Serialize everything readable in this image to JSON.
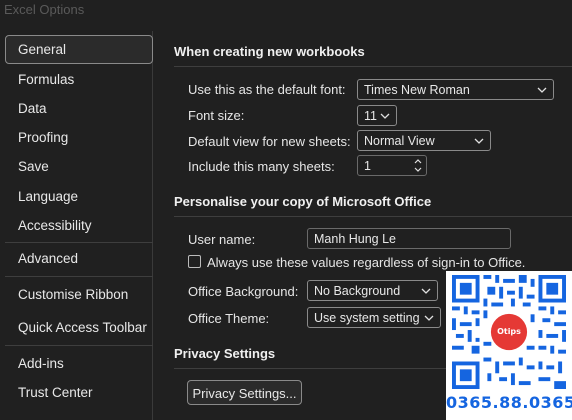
{
  "window": {
    "title": "Excel Options"
  },
  "sidebar": {
    "items": [
      {
        "label": "General"
      },
      {
        "label": "Formulas"
      },
      {
        "label": "Data"
      },
      {
        "label": "Proofing"
      },
      {
        "label": "Save"
      },
      {
        "label": "Language"
      },
      {
        "label": "Accessibility"
      },
      {
        "label": "Advanced"
      },
      {
        "label": "Customise Ribbon"
      },
      {
        "label": "Quick Access Toolbar"
      },
      {
        "label": "Add-ins"
      },
      {
        "label": "Trust Center"
      }
    ]
  },
  "sections": {
    "new_workbooks": {
      "heading": "When creating new workbooks",
      "default_font_label": "Use this as the default font:",
      "default_font_value": "Times New Roman",
      "font_size_label": "Font size:",
      "font_size_value": "11",
      "default_view_label": "Default view for new sheets:",
      "default_view_value": "Normal View",
      "sheets_label": "Include this many sheets:",
      "sheets_value": "1"
    },
    "personalise": {
      "heading": "Personalise your copy of Microsoft Office",
      "user_name_label": "User name:",
      "user_name_value": "Manh Hung Le",
      "always_use_label": "Always use these values regardless of sign-in to Office.",
      "always_use_checked": false,
      "background_label": "Office Background:",
      "background_value": "No Background",
      "theme_label": "Office Theme:",
      "theme_value": "Use system setting"
    },
    "privacy": {
      "heading": "Privacy Settings",
      "button_label": "Privacy Settings..."
    }
  },
  "watermark": {
    "logo_text": "Otips",
    "phone": "0365.88.0365",
    "colors": {
      "qr": "#1565e0",
      "logo": "#e53935"
    }
  },
  "colors": {
    "background": "#202020",
    "text": "#e6e6e6",
    "border": "#8a8a8a"
  }
}
